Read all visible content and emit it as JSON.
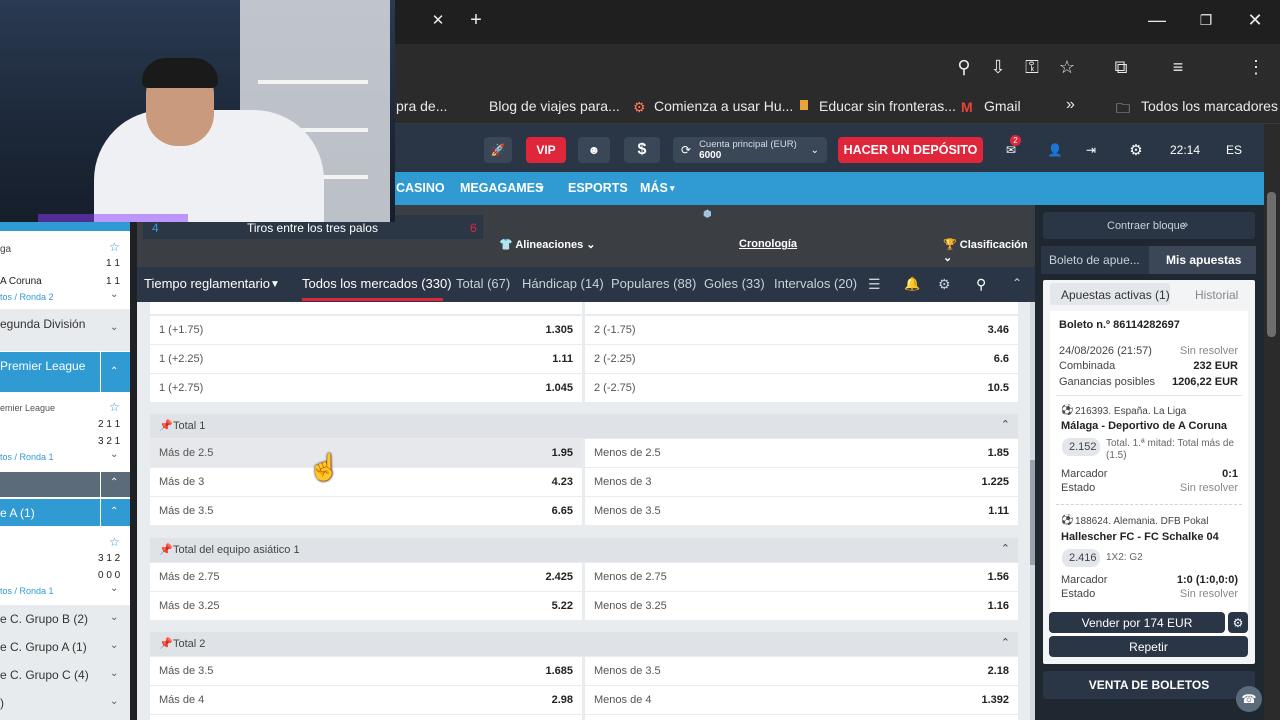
{
  "browser": {
    "tab_close": "✕",
    "new_tab": "+",
    "bookmarks": [
      {
        "label": "pra de...",
        "icon": "none"
      },
      {
        "label": "Blog de viajes para...",
        "icon": "none"
      },
      {
        "label": "Comienza a usar Hu...",
        "icon": "hubspot-icon"
      },
      {
        "label": "Educar sin fronteras...",
        "icon": "site-icon"
      },
      {
        "label": "Gmail",
        "icon": "gmail-icon"
      }
    ],
    "more_bookmarks": "»",
    "all_bookmarks": "Todos los marcadores"
  },
  "header": {
    "vip": "VIP",
    "dollar": "$",
    "account_label": "Cuenta principal (EUR)",
    "account_balance": "6000",
    "deposit_button": "HACER UN DEPÓSITO",
    "mail_badge": "2",
    "time": "22:14",
    "language": "ES"
  },
  "nav": {
    "items": [
      "CASINO",
      "MEGAGAMES",
      "ESPORTS",
      "MÁS"
    ]
  },
  "sidebar": {
    "top_cut": "",
    "liga_row": "ga",
    "coruna_row": "A Coruna",
    "coruna_score": "1 1",
    "first_score": "1 1",
    "round1": "tos / Ronda 2",
    "segunda": "egunda División",
    "premier": "Premier League",
    "premier_sub": "emier League",
    "premier_score1": "2 1 1",
    "premier_score2": "3 2 1",
    "round2": "tos / Ronda 1",
    "group_a1": "e A (1)",
    "score3": "3 1 2",
    "score4": "0 0 0",
    "round3": "tos / Ronda 1",
    "grupo_b": "e C. Grupo B (2)",
    "grupo_a": "e C. Grupo A (1)",
    "grupo_c": "e C. Grupo C (4)",
    "last": ")"
  },
  "match": {
    "stat_left": "4",
    "stat_label": "Tiros entre los tres palos",
    "stat_right": "6",
    "lineups": "Alineaciones",
    "timeline": "Cronología",
    "standings": "Clasificación"
  },
  "market_tabs": {
    "period": "Tiempo reglamentario",
    "tabs": [
      "Todos los mercados (330)",
      "Total (67)",
      "Hándicap (14)",
      "Populares (88)",
      "Goles (33)",
      "Intervalos (20)"
    ]
  },
  "markets": {
    "handicap_rows": [
      {
        "left": "1 (+1.75)",
        "left_odd": "1.305",
        "right": "2 (-1.75)",
        "right_odd": "3.46"
      },
      {
        "left": "1 (+2.25)",
        "left_odd": "1.11",
        "right": "2 (-2.25)",
        "right_odd": "6.6"
      },
      {
        "left": "1 (+2.75)",
        "left_odd": "1.045",
        "right": "2 (-2.75)",
        "right_odd": "10.5"
      }
    ],
    "total1_title": "Total 1",
    "total1_rows": [
      {
        "left": "Más de 2.5",
        "left_odd": "1.95",
        "right": "Menos de 2.5",
        "right_odd": "1.85"
      },
      {
        "left": "Más de 3",
        "left_odd": "4.23",
        "right": "Menos de 3",
        "right_odd": "1.225"
      },
      {
        "left": "Más de 3.5",
        "left_odd": "6.65",
        "right": "Menos de 3.5",
        "right_odd": "1.11"
      }
    ],
    "asian_title": "Total del equipo asiático 1",
    "asian_rows": [
      {
        "left": "Más de 2.75",
        "left_odd": "2.425",
        "right": "Menos de 2.75",
        "right_odd": "1.56"
      },
      {
        "left": "Más de 3.25",
        "left_odd": "5.22",
        "right": "Menos de 3.25",
        "right_odd": "1.16"
      }
    ],
    "total2_title": "Total 2",
    "total2_rows": [
      {
        "left": "Más de 3.5",
        "left_odd": "1.685",
        "right": "Menos de 3.5",
        "right_odd": "2.18"
      },
      {
        "left": "Más de 4",
        "left_odd": "2.98",
        "right": "Menos de 4",
        "right_odd": "1.392"
      }
    ]
  },
  "betslip": {
    "collapse": "Contraer bloque",
    "tab_slip": "Boleto de apue...",
    "tab_mybets": "Mis apuestas",
    "active": "Apuestas activas (1)",
    "history": "Historial",
    "ticket": "Boleto n.º 86114282697",
    "date": "24/08/2026 (21:57)",
    "status_unresolved": "Sin resolver",
    "type": "Combinada",
    "amount": "232 EUR",
    "winnings_label": "Ganancias posibles",
    "winnings": "1206,22 EUR",
    "bet1_league": "216393. España. La Liga",
    "bet1_match": "Málaga - Deportivo de A Coruna",
    "bet1_odd": "2.152",
    "bet1_market": "Total. 1.ª mitad: Total más de (1.5)",
    "marker_label": "Marcador",
    "state_label": "Estado",
    "bet1_score": "0:1",
    "bet2_league": "188624. Alemania. DFB Pokal",
    "bet2_match": "Hallescher FC - FC Schalke 04",
    "bet2_odd": "2.416",
    "bet2_market": "1X2: G2",
    "bet2_score": "1:0 (1:0,0:0)",
    "sell_button": "Vender por 174 EUR",
    "repeat_button": "Repetir",
    "sale_section": "VENTA DE BOLETOS"
  },
  "colors": {
    "accent": "#2f9bd2",
    "deposit": "#e0263a",
    "header": "#2a3645",
    "tab_underline": "#e0263a"
  }
}
